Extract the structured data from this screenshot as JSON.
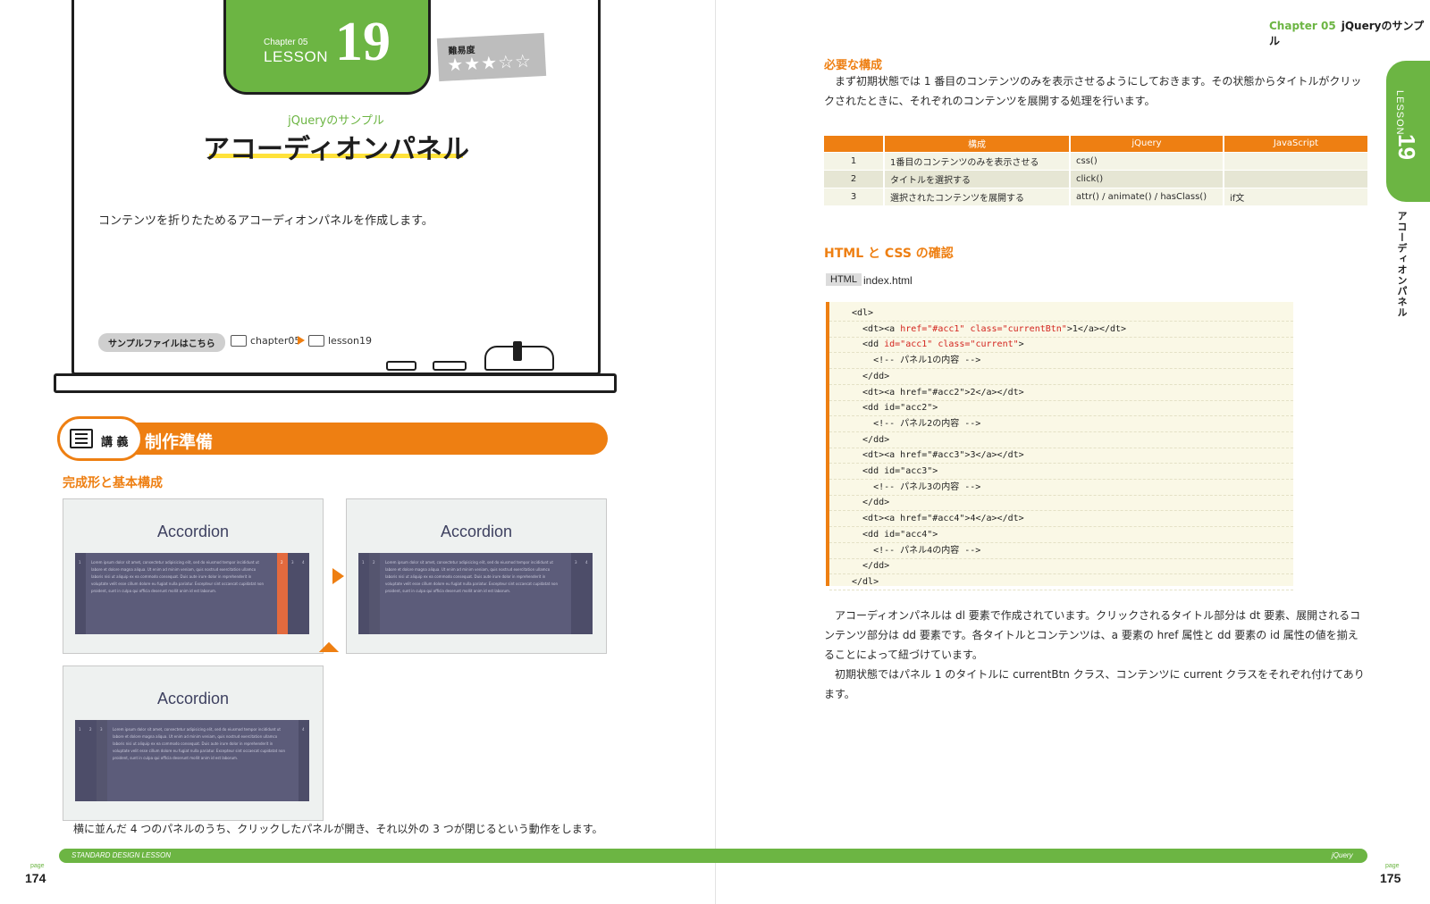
{
  "left_page": {
    "lesson_tag": {
      "chapter": "Chapter 05",
      "lesson": "LESSON",
      "number": "19"
    },
    "difficulty": {
      "label": "難易度",
      "stars": "★★★☆☆"
    },
    "subtitle": "jQueryのサンプル",
    "title": "アコーディオンパネル",
    "intro": "コンテンツを折りたためるアコーディオンパネルを作成します。",
    "sample_files": {
      "label": "サンプルファイルはこちら",
      "folder1": "chapter05",
      "folder2": "lesson19"
    },
    "section": {
      "badge": "講 義",
      "title": "制作準備"
    },
    "subsection": "完成形と基本構成",
    "screens": [
      {
        "heading": "Accordion",
        "nums": [
          "1",
          "2",
          "3",
          "4"
        ]
      },
      {
        "heading": "Accordion",
        "nums": [
          "1",
          "2",
          "3",
          "4"
        ]
      },
      {
        "heading": "Accordion",
        "nums": [
          "1",
          "2",
          "3",
          "4"
        ]
      }
    ],
    "dummy_text": "Lorem ipsum dolor sit amet, consectetur adipisicing elit, sed do eiusmod tempor incididunt ut labore et dolore magna aliqua. Ut enim ad minim veniam, quis nostrud exercitation ullamco laboris nisi ut aliquip ex ea commodo consequat. Duis aute irure dolor in reprehenderit in voluptate velit esse cillum dolore eu fugiat nulla pariatur. Excepteur sint occaecat cupidatat non proident, sunt in culpa qui officia deserunt mollit anim id est laborum.",
    "caption": "横に並んだ 4 つのパネルのうち、クリックしたパネルが開き、それ以外の 3 つが閉じるという動作をします。",
    "page_label": "page",
    "page_number": "174",
    "footer": "STANDARD DESIGN LESSON"
  },
  "right_page": {
    "running_head": {
      "chapter": "Chapter 05",
      "title": "jQueryのサンプル"
    },
    "side_tab": {
      "lesson": "LESSON",
      "number": "19",
      "title": "アコーディオンパネル"
    },
    "section1": {
      "heading": "必要な構成",
      "body": "まず初期状態では 1 番目のコンテンツのみを表示させるようにしておきます。その状態からタイトルがクリックされたときに、それぞれのコンテンツを展開する処理を行います。"
    },
    "table": {
      "headers": [
        "",
        "構成",
        "jQuery",
        "JavaScript"
      ],
      "rows": [
        [
          "1",
          "1番目のコンテンツのみを表示させる",
          "css()",
          ""
        ],
        [
          "2",
          "タイトルを選択する",
          "click()",
          ""
        ],
        [
          "3",
          "選択されたコンテンツを展開する",
          "attr() / animate() / hasClass()",
          "if文"
        ]
      ]
    },
    "section2": {
      "heading": "HTML と CSS の確認",
      "file_tag": "HTML",
      "file_name": "index.html"
    },
    "code": [
      {
        "indent": "",
        "pre": "<dl>",
        "attr": "",
        "post": ""
      },
      {
        "indent": "  ",
        "pre": "<dt><a ",
        "attr": "href=\"#acc1\" class=\"currentBtn\"",
        "post": ">1</a></dt>"
      },
      {
        "indent": "  ",
        "pre": "<dd ",
        "attr": "id=\"acc1\" class=\"current\"",
        "post": ">"
      },
      {
        "indent": "    ",
        "pre": "<!-- パネル1の内容 -->",
        "attr": "",
        "post": ""
      },
      {
        "indent": "  ",
        "pre": "</dd>",
        "attr": "",
        "post": ""
      },
      {
        "indent": "  ",
        "pre": "<dt><a href=\"#acc2\">2</a></dt>",
        "attr": "",
        "post": ""
      },
      {
        "indent": "  ",
        "pre": "<dd id=\"acc2\">",
        "attr": "",
        "post": ""
      },
      {
        "indent": "    ",
        "pre": "<!-- パネル2の内容 -->",
        "attr": "",
        "post": ""
      },
      {
        "indent": "  ",
        "pre": "</dd>",
        "attr": "",
        "post": ""
      },
      {
        "indent": "  ",
        "pre": "<dt><a href=\"#acc3\">3</a></dt>",
        "attr": "",
        "post": ""
      },
      {
        "indent": "  ",
        "pre": "<dd id=\"acc3\">",
        "attr": "",
        "post": ""
      },
      {
        "indent": "    ",
        "pre": "<!-- パネル3の内容 -->",
        "attr": "",
        "post": ""
      },
      {
        "indent": "  ",
        "pre": "</dd>",
        "attr": "",
        "post": ""
      },
      {
        "indent": "  ",
        "pre": "<dt><a href=\"#acc4\">4</a></dt>",
        "attr": "",
        "post": ""
      },
      {
        "indent": "  ",
        "pre": "<dd id=\"acc4\">",
        "attr": "",
        "post": ""
      },
      {
        "indent": "    ",
        "pre": "<!-- パネル4の内容 -->",
        "attr": "",
        "post": ""
      },
      {
        "indent": "  ",
        "pre": "</dd>",
        "attr": "",
        "post": ""
      },
      {
        "indent": "",
        "pre": "</dl>",
        "attr": "",
        "post": ""
      }
    ],
    "body2": [
      "アコーディオンパネルは dl 要素で作成されています。クリックされるタイトル部分は dt 要素、展開されるコンテンツ部分は dd 要素です。各タイトルとコンテンツは、a 要素の href 属性と dd 要素の id 属性の値を揃えることによって紐づけています。",
      "初期状態ではパネル 1 のタイトルに currentBtn クラス、コンテンツに current クラスをそれぞれ付けてあります。"
    ],
    "page_label": "page",
    "page_number": "175",
    "footer": "jQuery"
  },
  "colors": {
    "accent_orange": "#ee7f12",
    "accent_green": "#6cb543",
    "panel": "#5c5c7a",
    "highlight": "#e36a3e"
  }
}
